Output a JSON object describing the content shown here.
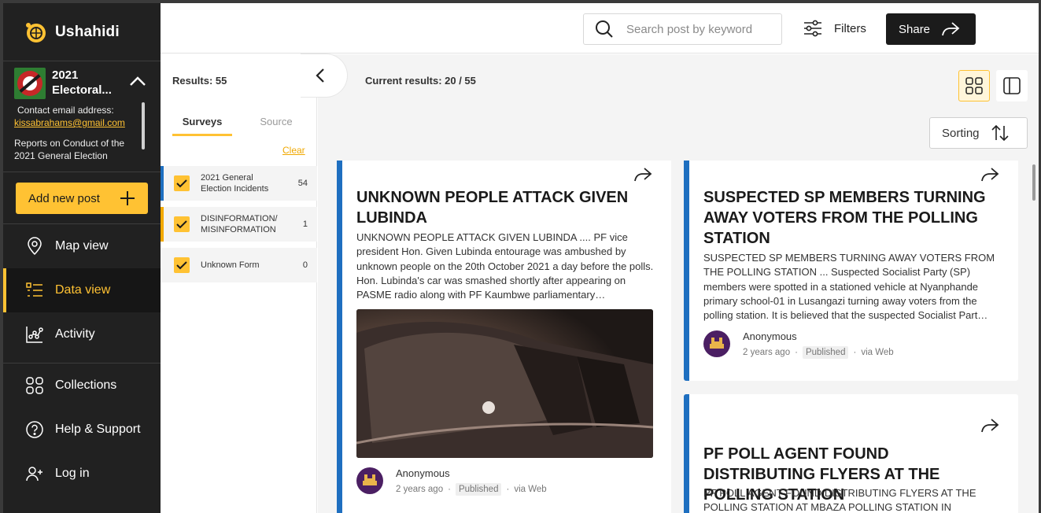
{
  "app": {
    "name": "Ushahidi"
  },
  "deployment": {
    "name": "2021 Electoral...",
    "contact_label": "Contact email address:",
    "email": "kissabrahams@gmail.com",
    "description": "Reports on Conduct of the 2021 General Election"
  },
  "add_post_label": "Add new post",
  "nav": [
    {
      "label": "Map view",
      "icon": "map-pin-icon"
    },
    {
      "label": "Data view",
      "icon": "data-list-icon",
      "active": true
    },
    {
      "label": "Activity",
      "icon": "activity-chart-icon"
    },
    {
      "label": "Collections",
      "icon": "collections-icon"
    },
    {
      "label": "Help & Support",
      "icon": "help-icon"
    },
    {
      "label": "Log in",
      "icon": "login-user-icon"
    }
  ],
  "header": {
    "search_placeholder": "Search post by keyword",
    "filters_label": "Filters",
    "share_label": "Share"
  },
  "filter_panel": {
    "results": "Results: 55",
    "tabs": [
      "Surveys",
      "Source"
    ],
    "clear_label": "Clear",
    "surveys": [
      {
        "label": "2021 General Election Incidents",
        "count": "54",
        "color": "#1e6fc0"
      },
      {
        "label": "DISINFORMATION/MISINFORMATION",
        "count": "1",
        "color": "#f2a900"
      },
      {
        "label": "Unknown Form",
        "count": "0",
        "color": ""
      }
    ]
  },
  "main": {
    "current_results": "Current results: 20 / 55",
    "sorting_label": "Sorting"
  },
  "posts": [
    {
      "title": "UNKNOWN PEOPLE ATTACK GIVEN LUBINDA",
      "excerpt": "UNKNOWN PEOPLE ATTACK GIVEN LUBINDA .... PF vice president Hon. Given Lubinda entourage was ambushed by unknown people on the 20th October 2021 a day before the polls. Hon. Lubinda's car was smashed shortly after appearing on PASME radio along with PF Kaumbwe parliamentary…",
      "author": "Anonymous",
      "time": "2 years ago",
      "status": "Published",
      "source": "via Web"
    },
    {
      "title": "SUSPECTED SP MEMBERS TURNING AWAY VOTERS FROM THE POLLING STATION",
      "excerpt": "SUSPECTED SP MEMBERS TURNING AWAY VOTERS FROM THE POLLING STATION ... Suspected Socialist Party (SP) members were spotted in a stationed vehicle at Nyanphande primary school-01 in Lusangazi turning away voters from the polling station. It is believed that the suspected Socialist Part…",
      "author": "Anonymous",
      "time": "2 years ago",
      "status": "Published",
      "source": "via Web"
    },
    {
      "title": "PF POLL AGENT FOUND DISTRIBUTING FLYERS AT THE POLLING STATION",
      "excerpt": "PF POLL AGENT FOUND DISTRIBUTING FLYERS AT THE POLLING STATION AT MBAZA POLLING STATION IN"
    }
  ],
  "colors": {
    "accent": "#ffc233",
    "sidebar": "#212121",
    "post_border": "#1e6fc0"
  }
}
